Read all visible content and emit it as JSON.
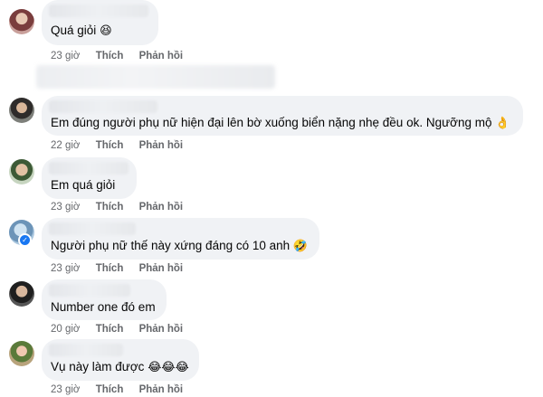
{
  "comments": [
    {
      "text": "Quá giỏi",
      "emoji": "😆",
      "time": "23 giờ",
      "like": "Thích",
      "reply": "Phản hồi"
    },
    {
      "text": "Em đúng người phụ nữ hiện đại lên bờ xuống biển nặng nhẹ đều ok. Ngưỡng mộ",
      "emoji": "👌",
      "time": "22 giờ",
      "like": "Thích",
      "reply": "Phản hồi"
    },
    {
      "text": "Em quá giỏi",
      "emoji": "",
      "time": "23 giờ",
      "like": "Thích",
      "reply": "Phản hồi"
    },
    {
      "text": "Người phụ nữ thế này xứng đáng có 10 anh",
      "emoji": "🤣",
      "time": "23 giờ",
      "like": "Thích",
      "reply": "Phản hồi"
    },
    {
      "text": "Number one đó em",
      "emoji": "",
      "time": "20 giờ",
      "like": "Thích",
      "reply": "Phản hồi"
    },
    {
      "text": "Vụ này làm được",
      "emoji": "😂😂😂",
      "time": "23 giờ",
      "like": "Thích",
      "reply": "Phản hồi"
    }
  ],
  "colors": {
    "bubble": "#f0f2f5",
    "meta": "#65676b",
    "text": "#050505",
    "badge": "#1877f2"
  }
}
